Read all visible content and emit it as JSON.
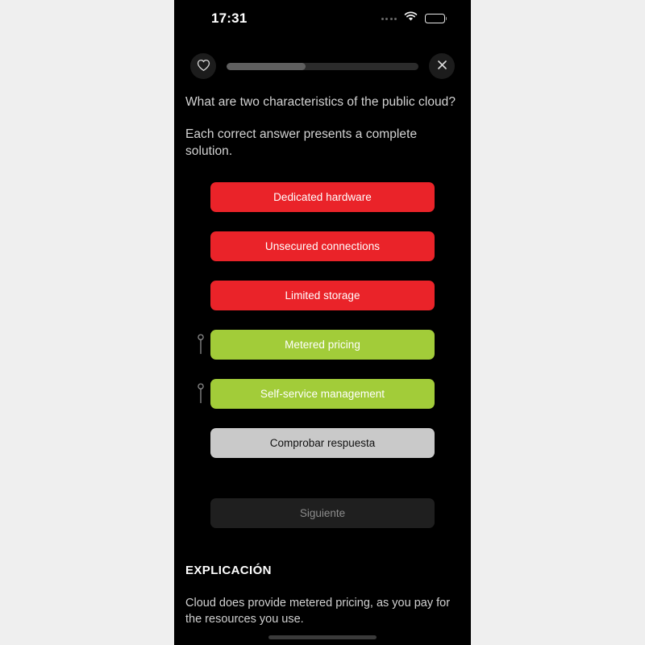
{
  "status_bar": {
    "time": "17:31",
    "signal_icon": "signal-dots-icon",
    "wifi_icon": "wifi-icon",
    "battery_icon": "battery-icon"
  },
  "toolbar": {
    "favorite_icon": "heart-icon",
    "close_icon": "close-icon",
    "progress_percent": 41
  },
  "question": {
    "text": "What are two characteristics of the public cloud?",
    "instruction": "Each correct answer presents a complete solution."
  },
  "options": [
    {
      "label": "Dedicated hardware",
      "state": "wrong",
      "marked": false
    },
    {
      "label": "Unsecured connections",
      "state": "wrong",
      "marked": false
    },
    {
      "label": "Limited storage",
      "state": "wrong",
      "marked": false
    },
    {
      "label": "Metered pricing",
      "state": "right",
      "marked": true
    },
    {
      "label": "Self-service management",
      "state": "right",
      "marked": true
    }
  ],
  "actions": {
    "check_label": "Comprobar respuesta",
    "next_label": "Siguiente"
  },
  "explanation": {
    "title": "EXPLICACIÓN",
    "body": "Cloud does provide metered pricing, as you pay for the resources you use."
  },
  "colors": {
    "wrong": "#ea2329",
    "right": "#a2cc39",
    "check_button": "#c9c9c9",
    "next_button": "#1f1f1f",
    "screen_background": "#000000",
    "page_background": "#efefef"
  }
}
